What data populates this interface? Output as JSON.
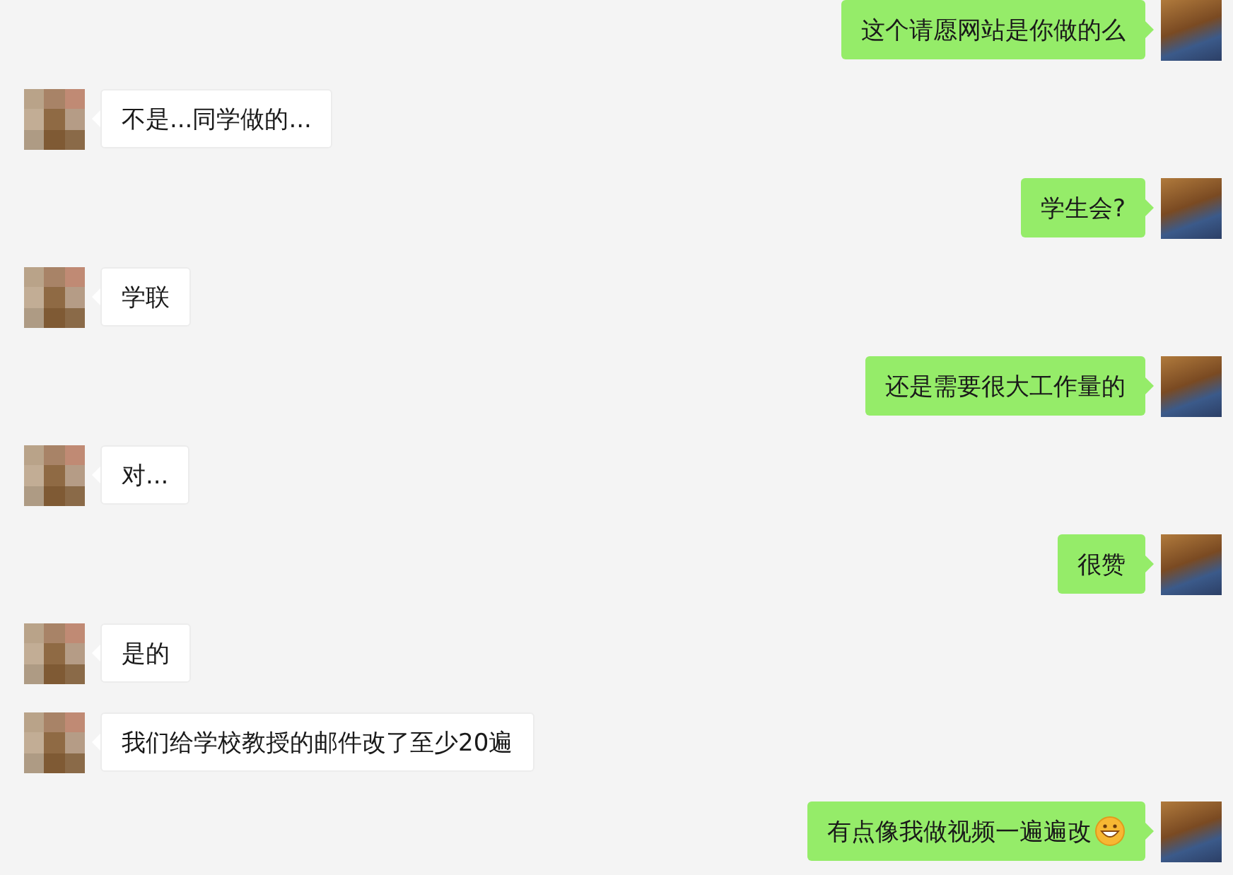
{
  "messages": [
    {
      "kind": "sent",
      "text": "这个请愿网站是你做的么"
    },
    {
      "kind": "received",
      "text": "不是...同学做的..."
    },
    {
      "kind": "sent",
      "text": "学生会?"
    },
    {
      "kind": "received",
      "text": "学联"
    },
    {
      "kind": "sent",
      "text": "还是需要很大工作量的"
    },
    {
      "kind": "received",
      "text": "对..."
    },
    {
      "kind": "sent",
      "text": "很赞"
    },
    {
      "kind": "received",
      "text": "是的"
    },
    {
      "kind": "received",
      "text": "我们给学校教授的邮件改了至少20遍"
    },
    {
      "kind": "sent",
      "text": "有点像我做视频一遍遍改",
      "trailing_icon": true
    }
  ]
}
